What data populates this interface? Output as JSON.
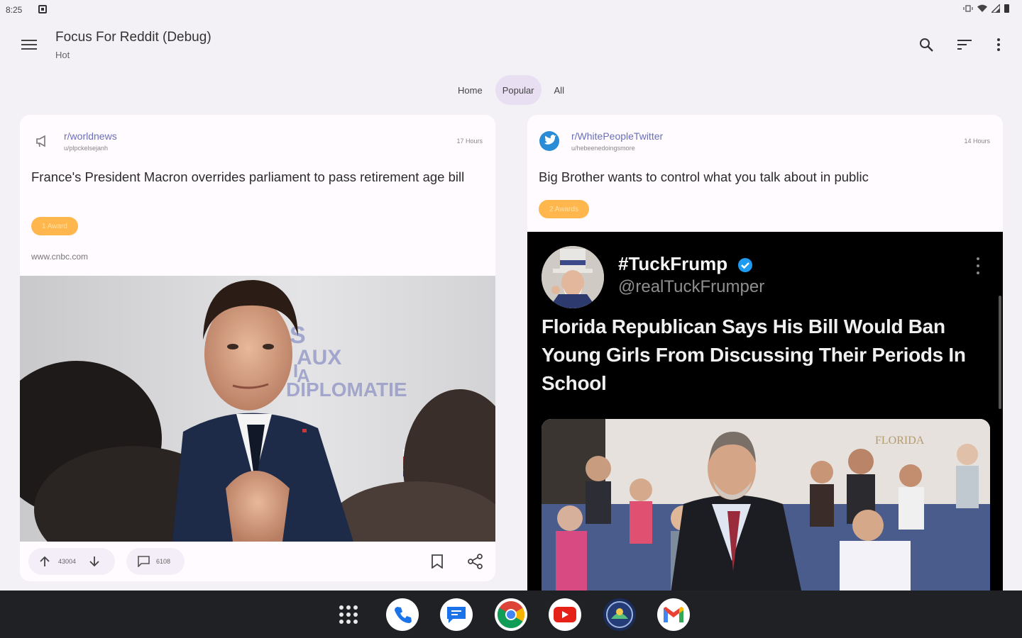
{
  "status_bar": {
    "time": "8:25",
    "icons": [
      "notification-icon",
      "vibrate-icon",
      "wifi-icon",
      "signal-icon",
      "battery-icon"
    ]
  },
  "toolbar": {
    "title": "Focus For Reddit (Debug)",
    "subtitle": "Hot",
    "actions": [
      "search-icon",
      "sort-icon",
      "more-vert-icon"
    ]
  },
  "tabs": [
    {
      "label": "Home",
      "active": false
    },
    {
      "label": "Popular",
      "active": true
    },
    {
      "label": "All",
      "active": false
    }
  ],
  "posts": [
    {
      "subreddit": "r/worldnews",
      "user": "u/plpckelsejanh",
      "time": "17 Hours",
      "title": "France's President Macron overrides parliament to pass retirement age bill",
      "award": "1 Award",
      "domain": "www.cnbc.com",
      "image": "macron-photo",
      "score": "43004",
      "comments": "6108"
    },
    {
      "subreddit": "r/WhitePeopleTwitter",
      "user": "u/hebeenedoingsmore",
      "time": "14 Hours",
      "title": "Big Brother wants to control what you talk about in public",
      "award": "2 Awards",
      "tweet": {
        "name": "#TuckFrump",
        "handle": "@realTuckFrumper",
        "text": "Florida Republican Says His Bill Would Ban Young Girls From Discussing Their Periods In School",
        "image": "florida-hearing-photo"
      }
    }
  ],
  "taskbar": {
    "apps": [
      "apps-grid-icon",
      "phone-app-icon",
      "messages-app-icon",
      "chrome-app-icon",
      "youtube-app-icon",
      "focus-reddit-app-icon",
      "gmail-app-icon"
    ]
  },
  "colors": {
    "background": "#f3f0f6",
    "card": "#fffbff",
    "active_tab": "#e8dff2",
    "subreddit_link": "#6a6fb8",
    "award": "#ffb74d",
    "taskbar": "#1f2125"
  }
}
